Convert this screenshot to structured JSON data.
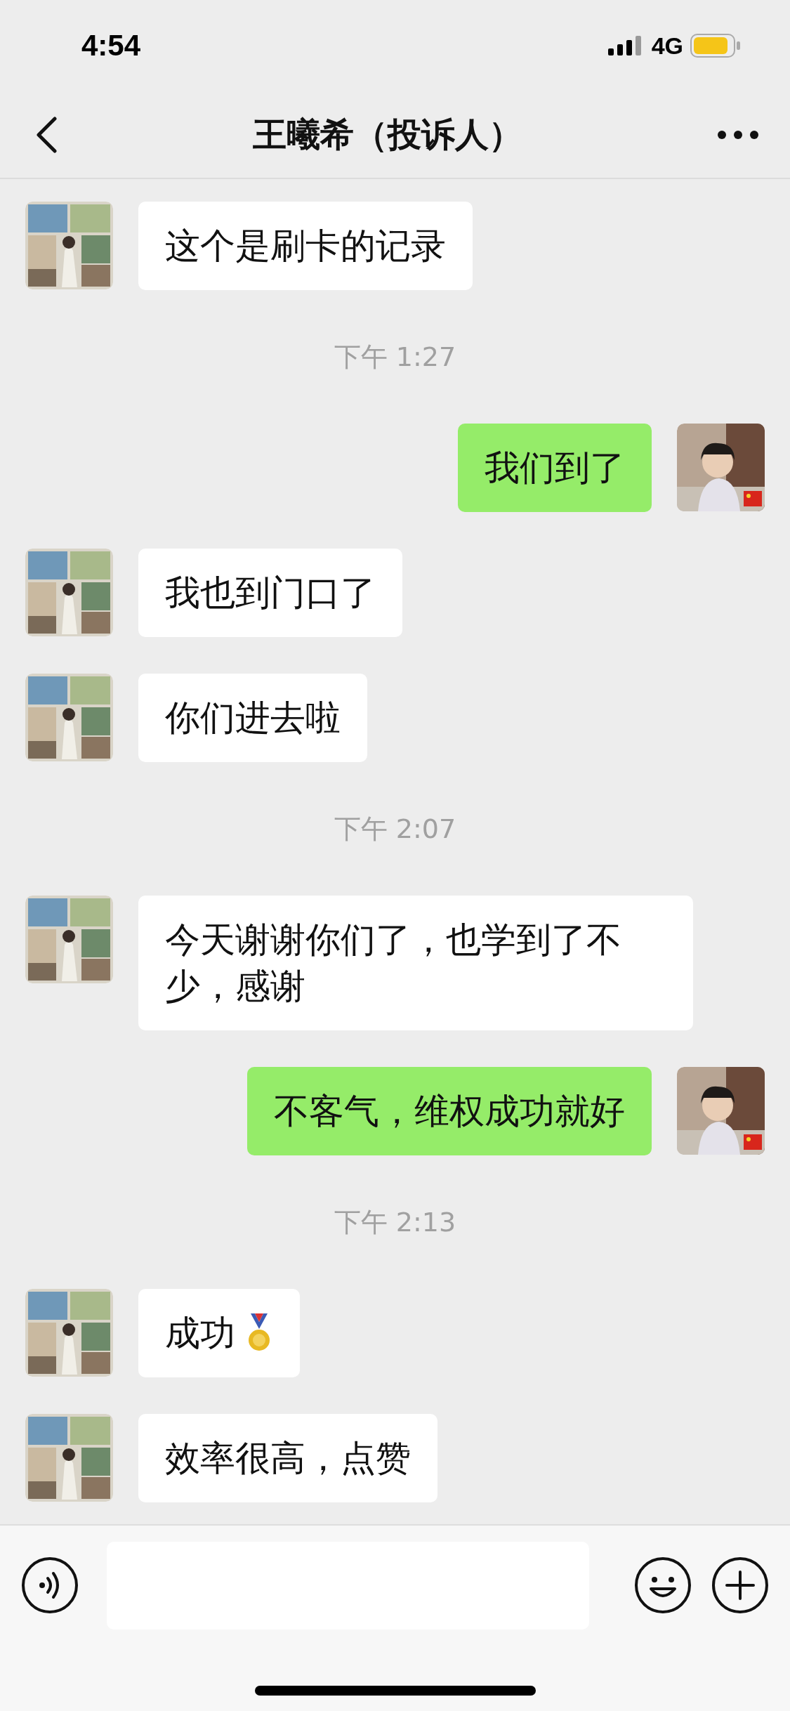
{
  "status_bar": {
    "time": "4:54",
    "network": "4G"
  },
  "header": {
    "title": "王曦希（投诉人）"
  },
  "messages": [
    {
      "kind": "received",
      "text": "这个是刷卡的记录",
      "medal": false
    },
    {
      "kind": "time",
      "text": "下午 1:27"
    },
    {
      "kind": "sent",
      "text": "我们到了",
      "medal": false
    },
    {
      "kind": "received",
      "text": "我也到门口了",
      "medal": false
    },
    {
      "kind": "received",
      "text": "你们进去啦",
      "medal": false
    },
    {
      "kind": "time",
      "text": "下午 2:07"
    },
    {
      "kind": "received",
      "text": "今天谢谢你们了，也学到了不少，感谢",
      "medal": false
    },
    {
      "kind": "sent",
      "text": "不客气，维权成功就好",
      "medal": false
    },
    {
      "kind": "time",
      "text": "下午 2:13"
    },
    {
      "kind": "received",
      "text": "成功",
      "medal": true
    },
    {
      "kind": "received",
      "text": "效率很高，点赞",
      "medal": false
    }
  ]
}
